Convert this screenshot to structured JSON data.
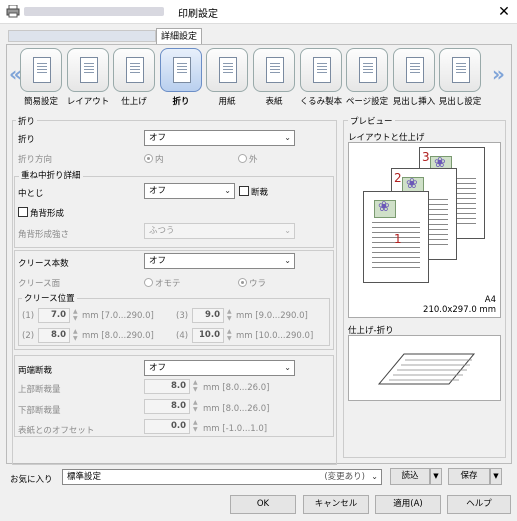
{
  "window": {
    "title": "印刷設定",
    "close_glyph": "✕"
  },
  "tabs": {
    "active": "詳細設定"
  },
  "toolbar": {
    "items": [
      {
        "label": "簡易設定",
        "icon": "quick-setup-icon"
      },
      {
        "label": "レイアウト",
        "icon": "layout-icon"
      },
      {
        "label": "仕上げ",
        "icon": "finishing-icon"
      },
      {
        "label": "折り",
        "icon": "fold-icon",
        "selected": true
      },
      {
        "label": "用紙",
        "icon": "paper-icon"
      },
      {
        "label": "表紙",
        "icon": "cover-icon"
      },
      {
        "label": "くるみ製本",
        "icon": "perfect-binding-icon"
      },
      {
        "label": "ページ設定",
        "icon": "page-setup-icon"
      },
      {
        "label": "見出し挿入",
        "icon": "tab-insert-icon"
      },
      {
        "label": "見出し設定",
        "icon": "tab-settings-icon"
      }
    ]
  },
  "fold": {
    "group_label": "折り",
    "fold_label": "折り",
    "fold_value": "オフ",
    "direction_label": "折り方向",
    "direction_in": "内",
    "direction_out": "外"
  },
  "saddle": {
    "group_label": "重ね中折り詳細",
    "center_label": "中とじ",
    "center_value": "オフ",
    "trim_label": "断裁",
    "square_label": "角背形成",
    "strength_label": "角背形成強さ",
    "strength_value": "ふつう"
  },
  "crease": {
    "count_label": "クリース本数",
    "count_value": "オフ",
    "side_label": "クリース面",
    "side_front": "オモテ",
    "side_back": "ウラ",
    "pos_group_label": "クリース位置",
    "positions": [
      {
        "idx": "(1)",
        "value": "7.0",
        "range": "mm [7.0...290.0]"
      },
      {
        "idx": "(2)",
        "value": "8.0",
        "range": "mm [8.0...290.0]"
      },
      {
        "idx": "(3)",
        "value": "9.0",
        "range": "mm [9.0...290.0]"
      },
      {
        "idx": "(4)",
        "value": "10.0",
        "range": "mm [10.0...290.0]"
      }
    ]
  },
  "trim": {
    "label": "両端断裁",
    "value": "オフ",
    "top_label": "上部断裁量",
    "top_value": "8.0",
    "top_range": "mm [8.0...26.0]",
    "bottom_label": "下部断裁量",
    "bottom_value": "8.0",
    "bottom_range": "mm [8.0...26.0]",
    "offset_label": "表紙とのオフセット",
    "offset_value": "0.0",
    "offset_range": "mm [-1.0...1.0]"
  },
  "preview": {
    "group_label": "プレビュー",
    "layout_label": "レイアウトと仕上げ",
    "paper_size": "A4",
    "paper_dims": "210.0x297.0 mm",
    "page_numbers": [
      "1",
      "2",
      "3"
    ],
    "fold_label": "仕上げ-折り"
  },
  "favorites": {
    "label": "お気に入り",
    "value": "標準設定",
    "changed": "(変更あり)",
    "load_label": "読込",
    "save_label": "保存"
  },
  "buttons": {
    "ok": "OK",
    "cancel": "キャンセル",
    "apply": "適用(A)",
    "help": "ヘルプ"
  }
}
